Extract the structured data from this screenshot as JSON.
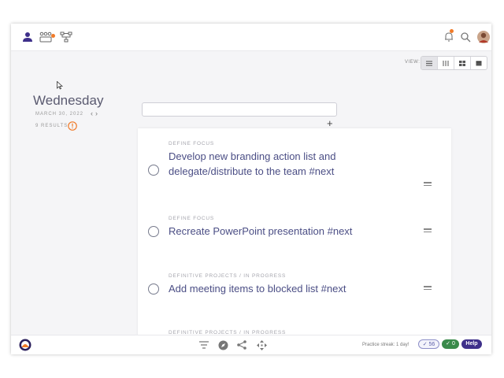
{
  "colors": {
    "accent": "#3e2f8a",
    "orange": "#f07a28",
    "title_text": "#4b4e85",
    "success": "#3a8a4a"
  },
  "topbar": {
    "left_icons": [
      "user-icon",
      "team-icon",
      "hierarchy-icon"
    ],
    "right_icons": [
      "bell-icon",
      "search-icon",
      "avatar"
    ]
  },
  "view": {
    "label": "VIEW:",
    "options": [
      "list-view-icon",
      "columns-view-icon",
      "grid-view-icon",
      "calendar-view-icon"
    ],
    "active": "list-view-icon"
  },
  "date_panel": {
    "day": "Wednesday",
    "date": "MARCH 30, 2022",
    "nav_prev": "‹",
    "nav_next": "›",
    "results": "9 RESULTS"
  },
  "search": {
    "value": "",
    "add_label": "+"
  },
  "tasks": [
    {
      "category": "DEFINE FOCUS",
      "title": "Develop new branding action list and delegate/distribute to the team #next",
      "done": false
    },
    {
      "category": "DEFINE FOCUS",
      "title": "Recreate PowerPoint presentation #next",
      "done": false
    },
    {
      "category": "DEFINITIVE PROJECTS / IN PROGRESS",
      "title": "Add meeting items to blocked list #next",
      "done": false
    },
    {
      "category": "DEFINITIVE PROJECTS / IN PROGRESS",
      "title": "",
      "done": false
    }
  ],
  "bottombar": {
    "icons": [
      "filter-icon",
      "compass-icon",
      "share-icon",
      "move-icon"
    ],
    "streak": "Practice streak: 1 day!",
    "check_count": "✓ 56",
    "done_count": "✓ 0",
    "help": "Help"
  }
}
